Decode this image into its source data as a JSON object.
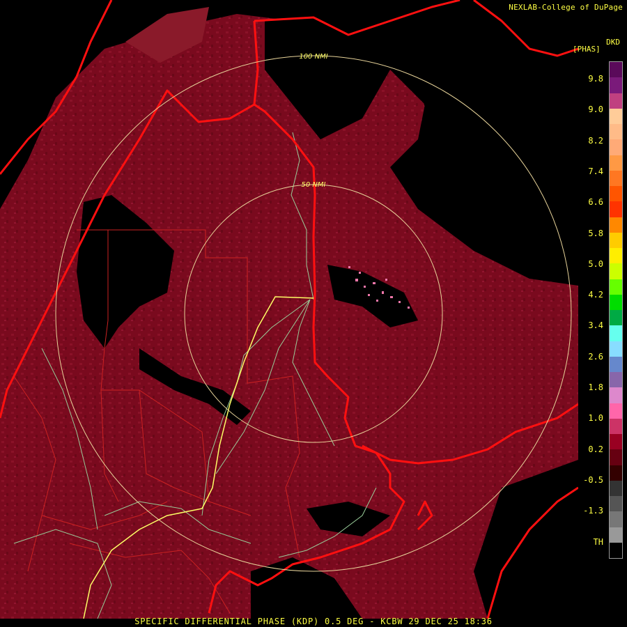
{
  "header": {
    "credit": "NEXLAB-College of DuPage",
    "product_code": "DKD",
    "units": "[PHAS]"
  },
  "range_rings": {
    "outer_label": "100 NMI",
    "inner_label": "50 NMI"
  },
  "legend": {
    "labels": [
      "9.8",
      "9.0",
      "8.2",
      "7.4",
      "6.6",
      "5.8",
      "5.0",
      "4.2",
      "3.4",
      "2.6",
      "1.8",
      "1.0",
      "0.2",
      "-0.5",
      "-1.3",
      "TH"
    ],
    "colors": [
      "#5a0a5a",
      "#7a1a7a",
      "#c04080",
      "#ffcc99",
      "#ffbb88",
      "#ffaa77",
      "#ff9944",
      "#ff7722",
      "#ff5500",
      "#ff3300",
      "#ff8800",
      "#ffcc00",
      "#ffee00",
      "#ccff00",
      "#66ff00",
      "#00dd00",
      "#00aa44",
      "#66ffee",
      "#88ddff",
      "#6688cc",
      "#8866aa",
      "#dd88cc",
      "#ff66aa",
      "#cc3366",
      "#990022",
      "#660011",
      "#330000",
      "#333333",
      "#555555",
      "#777777",
      "#999999",
      "#000000"
    ]
  },
  "footer": {
    "text": "SPECIFIC DIFFERENTIAL PHASE (KDP) 0.5 DEG - KCBW 29 DEC 25 18:36"
  },
  "map_colors": {
    "background": "#000000",
    "echo": "#7a0a1e",
    "border": "#ff1010",
    "county": "#cc2222",
    "roads": "#99cc99",
    "highway": "#ffff66",
    "ring": "#e8d49a"
  }
}
